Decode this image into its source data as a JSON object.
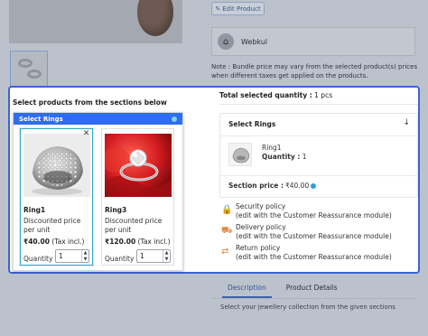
{
  "background": {
    "edit_button_label": "Edit Product",
    "seller_name": "Webkul",
    "note": "Note : Bundle price may vary from the selected product(s) prices when different taxes get applied on the products.",
    "tabs": [
      {
        "label": "Description",
        "active": true
      },
      {
        "label": "Product Details",
        "active": false
      }
    ],
    "description_text": "Select your jewellery collection from the given sections"
  },
  "bundle": {
    "title": "Select products from the sections below",
    "section": {
      "title": "Select Rings",
      "accent_color": "#2f6cf0",
      "products": [
        {
          "name": "Ring1",
          "price_label": "Discounted price per unit",
          "price": "₹40.00",
          "tax_note": "(Tax incl.)",
          "quantity_label": "Quantity",
          "quantity": "1",
          "selected": true,
          "remove_icon": "close-icon"
        },
        {
          "name": "Ring3",
          "price_label": "Discounted price per unit",
          "price": "₹120.00",
          "tax_note": "(Tax incl.)",
          "quantity_label": "Quantity",
          "quantity": "1",
          "selected": false
        }
      ]
    },
    "summary": {
      "total_label": "Total selected quantity :",
      "total_value": "1 pcs",
      "section_title": "Select Rings",
      "item_name": "Ring1",
      "item_qty_label": "Quantity :",
      "item_qty_value": "1",
      "section_price_label": "Section price :",
      "section_price_value": "₹40.00"
    },
    "policies": [
      {
        "title": "Security policy",
        "detail": "(edit with the Customer Reassurance module)",
        "icon": "shield-lock-icon"
      },
      {
        "title": "Delivery policy",
        "detail": "(edit with the Customer Reassurance module)",
        "icon": "truck-icon"
      },
      {
        "title": "Return policy",
        "detail": "(edit with the Customer Reassurance module)",
        "icon": "return-icon"
      }
    ]
  }
}
